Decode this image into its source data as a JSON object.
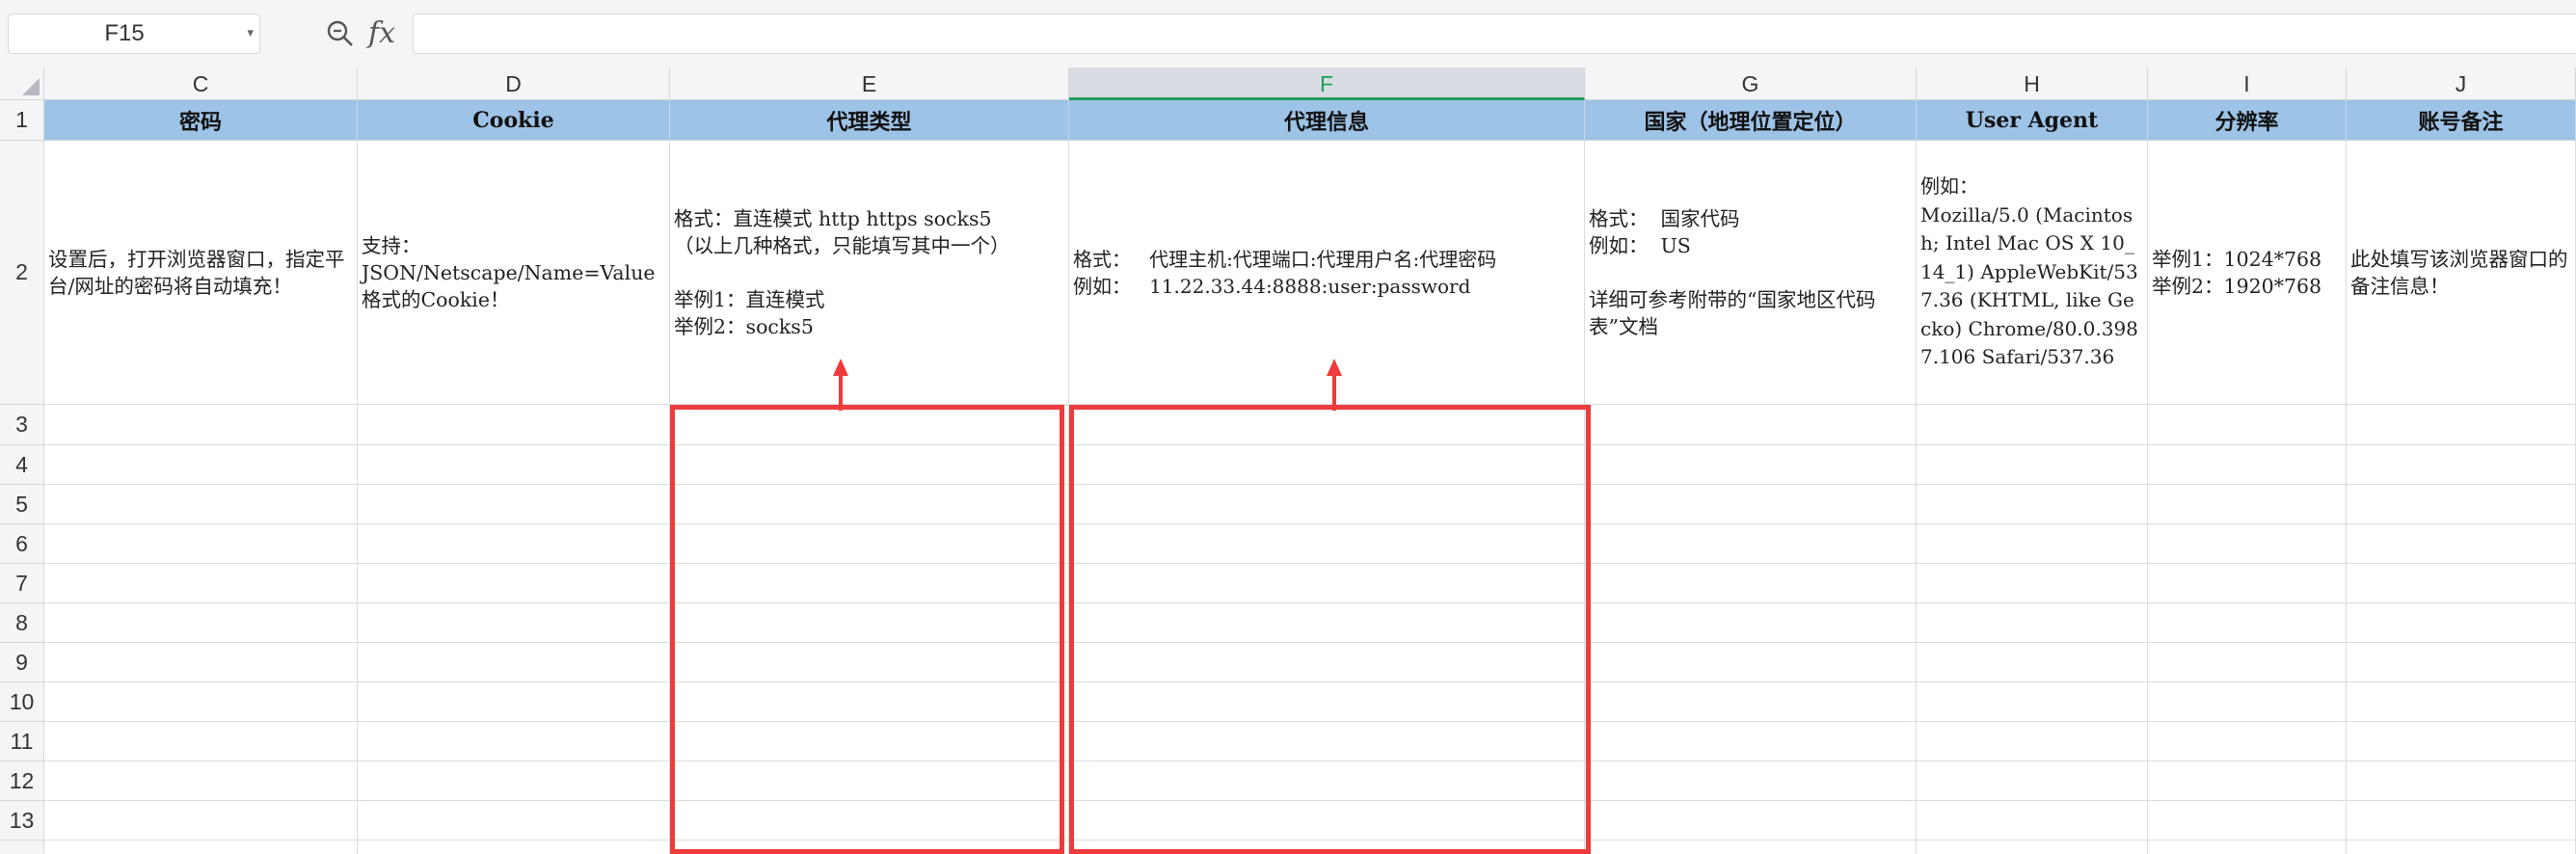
{
  "formula_bar": {
    "name_box": "F15",
    "fx_label": "fx",
    "formula_value": ""
  },
  "columns": [
    {
      "letter": "C"
    },
    {
      "letter": "D"
    },
    {
      "letter": "E"
    },
    {
      "letter": "F"
    },
    {
      "letter": "G"
    },
    {
      "letter": "H"
    },
    {
      "letter": "I"
    },
    {
      "letter": "J"
    }
  ],
  "rows": [
    "1",
    "2",
    "3",
    "4",
    "5",
    "6",
    "7",
    "8",
    "9",
    "10",
    "11",
    "12",
    "13"
  ],
  "header_row": {
    "c": "密码",
    "d": "Cookie",
    "e": "代理类型",
    "f": "代理信息",
    "g": "国家（地理位置定位）",
    "h": "User Agent",
    "i": "分辨率",
    "j": "账号备注"
  },
  "description_row": {
    "c": "设置后，打开浏览器窗口，指定平台/网址的密码将自动填充！",
    "d": "支持：\nJSON/Netscape/Name=Value格式的Cookie！",
    "e": "格式：直连模式 http https socks5\n（以上几种格式，只能填写其中一个）\n\n举例1：直连模式\n举例2：socks5",
    "f": "格式：   代理主机:代理端口:代理用户名:代理密码\n例如：   11.22.33.44:8888:user:password",
    "g": "格式：  国家代码\n例如：  US\n\n详细可参考附带的“国家地区代码表”文档",
    "h": "例如：\nMozilla/5.0 (Macintosh; Intel Mac OS X 10_14_1) AppleWebKit/537.36 (KHTML, like Gecko) Chrome/80.0.3987.106 Safari/537.36",
    "i": "举例1：1024*768\n举例2：1920*768",
    "j": "此处填写该浏览器窗口的备注信息！"
  },
  "selection": {
    "column": "F",
    "cell": "F15"
  },
  "colors": {
    "header_fill": "#9dc3e6",
    "annotation_red": "#ee3b3b",
    "selected_col_accent": "#1e9e5a"
  }
}
